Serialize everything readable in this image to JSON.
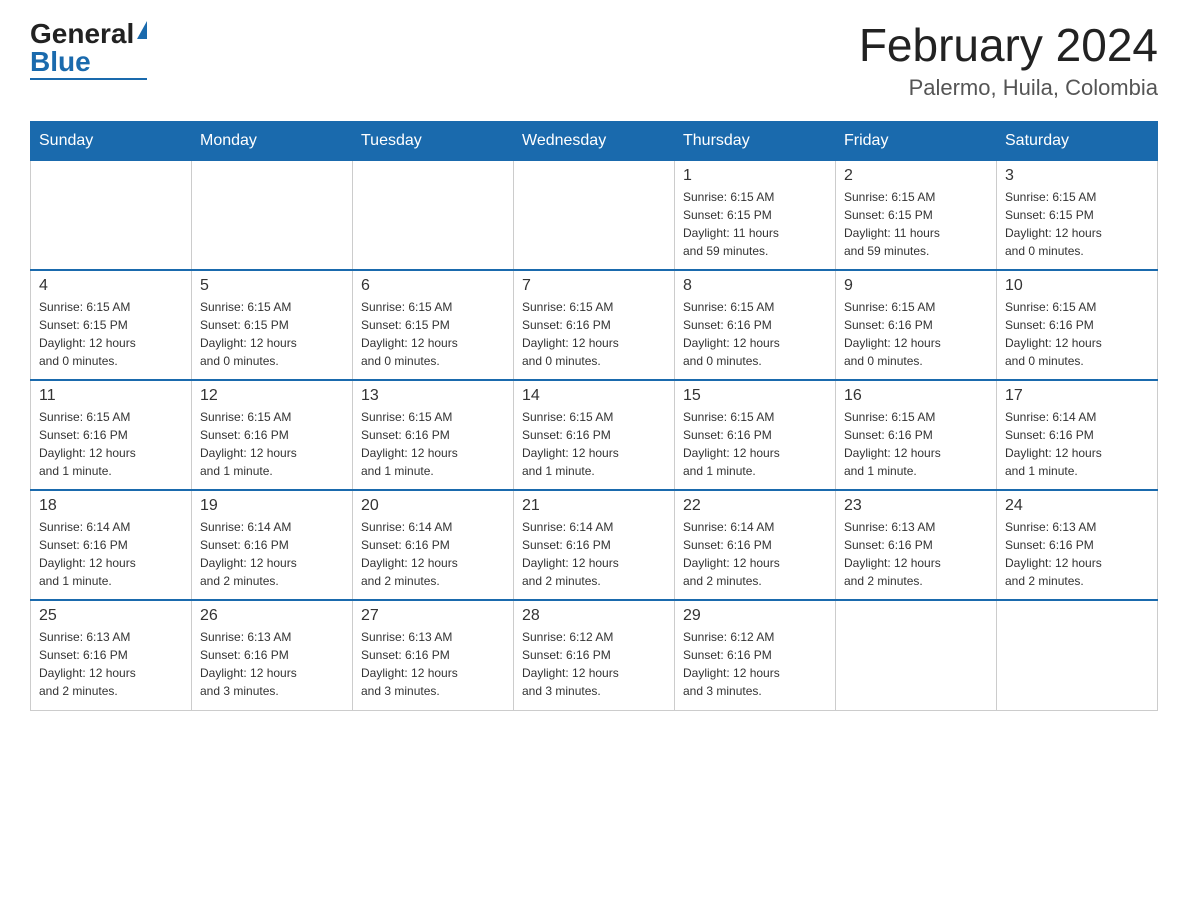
{
  "logo": {
    "general": "General",
    "blue": "Blue"
  },
  "title": {
    "month": "February 2024",
    "location": "Palermo, Huila, Colombia"
  },
  "weekdays": [
    "Sunday",
    "Monday",
    "Tuesday",
    "Wednesday",
    "Thursday",
    "Friday",
    "Saturday"
  ],
  "weeks": [
    [
      {
        "day": "",
        "info": ""
      },
      {
        "day": "",
        "info": ""
      },
      {
        "day": "",
        "info": ""
      },
      {
        "day": "",
        "info": ""
      },
      {
        "day": "1",
        "info": "Sunrise: 6:15 AM\nSunset: 6:15 PM\nDaylight: 11 hours\nand 59 minutes."
      },
      {
        "day": "2",
        "info": "Sunrise: 6:15 AM\nSunset: 6:15 PM\nDaylight: 11 hours\nand 59 minutes."
      },
      {
        "day": "3",
        "info": "Sunrise: 6:15 AM\nSunset: 6:15 PM\nDaylight: 12 hours\nand 0 minutes."
      }
    ],
    [
      {
        "day": "4",
        "info": "Sunrise: 6:15 AM\nSunset: 6:15 PM\nDaylight: 12 hours\nand 0 minutes."
      },
      {
        "day": "5",
        "info": "Sunrise: 6:15 AM\nSunset: 6:15 PM\nDaylight: 12 hours\nand 0 minutes."
      },
      {
        "day": "6",
        "info": "Sunrise: 6:15 AM\nSunset: 6:15 PM\nDaylight: 12 hours\nand 0 minutes."
      },
      {
        "day": "7",
        "info": "Sunrise: 6:15 AM\nSunset: 6:16 PM\nDaylight: 12 hours\nand 0 minutes."
      },
      {
        "day": "8",
        "info": "Sunrise: 6:15 AM\nSunset: 6:16 PM\nDaylight: 12 hours\nand 0 minutes."
      },
      {
        "day": "9",
        "info": "Sunrise: 6:15 AM\nSunset: 6:16 PM\nDaylight: 12 hours\nand 0 minutes."
      },
      {
        "day": "10",
        "info": "Sunrise: 6:15 AM\nSunset: 6:16 PM\nDaylight: 12 hours\nand 0 minutes."
      }
    ],
    [
      {
        "day": "11",
        "info": "Sunrise: 6:15 AM\nSunset: 6:16 PM\nDaylight: 12 hours\nand 1 minute."
      },
      {
        "day": "12",
        "info": "Sunrise: 6:15 AM\nSunset: 6:16 PM\nDaylight: 12 hours\nand 1 minute."
      },
      {
        "day": "13",
        "info": "Sunrise: 6:15 AM\nSunset: 6:16 PM\nDaylight: 12 hours\nand 1 minute."
      },
      {
        "day": "14",
        "info": "Sunrise: 6:15 AM\nSunset: 6:16 PM\nDaylight: 12 hours\nand 1 minute."
      },
      {
        "day": "15",
        "info": "Sunrise: 6:15 AM\nSunset: 6:16 PM\nDaylight: 12 hours\nand 1 minute."
      },
      {
        "day": "16",
        "info": "Sunrise: 6:15 AM\nSunset: 6:16 PM\nDaylight: 12 hours\nand 1 minute."
      },
      {
        "day": "17",
        "info": "Sunrise: 6:14 AM\nSunset: 6:16 PM\nDaylight: 12 hours\nand 1 minute."
      }
    ],
    [
      {
        "day": "18",
        "info": "Sunrise: 6:14 AM\nSunset: 6:16 PM\nDaylight: 12 hours\nand 1 minute."
      },
      {
        "day": "19",
        "info": "Sunrise: 6:14 AM\nSunset: 6:16 PM\nDaylight: 12 hours\nand 2 minutes."
      },
      {
        "day": "20",
        "info": "Sunrise: 6:14 AM\nSunset: 6:16 PM\nDaylight: 12 hours\nand 2 minutes."
      },
      {
        "day": "21",
        "info": "Sunrise: 6:14 AM\nSunset: 6:16 PM\nDaylight: 12 hours\nand 2 minutes."
      },
      {
        "day": "22",
        "info": "Sunrise: 6:14 AM\nSunset: 6:16 PM\nDaylight: 12 hours\nand 2 minutes."
      },
      {
        "day": "23",
        "info": "Sunrise: 6:13 AM\nSunset: 6:16 PM\nDaylight: 12 hours\nand 2 minutes."
      },
      {
        "day": "24",
        "info": "Sunrise: 6:13 AM\nSunset: 6:16 PM\nDaylight: 12 hours\nand 2 minutes."
      }
    ],
    [
      {
        "day": "25",
        "info": "Sunrise: 6:13 AM\nSunset: 6:16 PM\nDaylight: 12 hours\nand 2 minutes."
      },
      {
        "day": "26",
        "info": "Sunrise: 6:13 AM\nSunset: 6:16 PM\nDaylight: 12 hours\nand 3 minutes."
      },
      {
        "day": "27",
        "info": "Sunrise: 6:13 AM\nSunset: 6:16 PM\nDaylight: 12 hours\nand 3 minutes."
      },
      {
        "day": "28",
        "info": "Sunrise: 6:12 AM\nSunset: 6:16 PM\nDaylight: 12 hours\nand 3 minutes."
      },
      {
        "day": "29",
        "info": "Sunrise: 6:12 AM\nSunset: 6:16 PM\nDaylight: 12 hours\nand 3 minutes."
      },
      {
        "day": "",
        "info": ""
      },
      {
        "day": "",
        "info": ""
      }
    ]
  ]
}
